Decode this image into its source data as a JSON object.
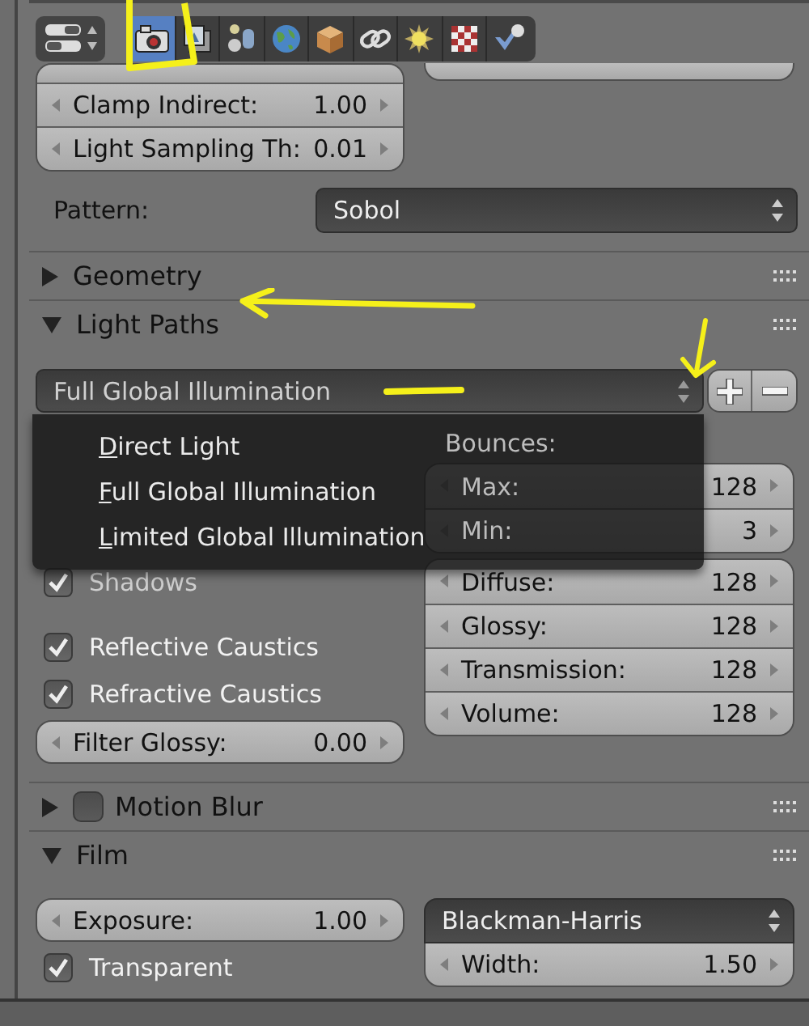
{
  "tab_bar": {
    "icons": [
      {
        "kind": "camera",
        "selected": true
      },
      {
        "kind": "layers",
        "selected": false
      },
      {
        "kind": "scene",
        "selected": false
      },
      {
        "kind": "world",
        "selected": false
      },
      {
        "kind": "object",
        "selected": false
      },
      {
        "kind": "chain",
        "selected": false
      },
      {
        "kind": "sun",
        "selected": false
      },
      {
        "kind": "checker",
        "selected": false
      },
      {
        "kind": "check",
        "selected": false
      }
    ]
  },
  "sampling": {
    "fields": [
      {
        "label": "Clamp Indirect:",
        "value": "1.00"
      },
      {
        "label": "Light Sampling Th:",
        "value": "0.01"
      }
    ],
    "pattern": {
      "label": "Pattern:",
      "value": "Sobol"
    }
  },
  "geometry": {
    "title": "Geometry",
    "expanded": false
  },
  "light_paths": {
    "title": "Light Paths",
    "expanded": true,
    "preset": "Full Global Illumination",
    "preset_menu": [
      "Direct Light",
      "Full Global Illumination",
      "Limited Global Illumination"
    ],
    "bounces_label": "Bounces:",
    "bounces": [
      {
        "label": "Max:",
        "value": "128"
      },
      {
        "label": "Min:",
        "value": "3"
      }
    ],
    "bounce_types": [
      {
        "label": "Diffuse:",
        "value": "128"
      },
      {
        "label": "Glossy:",
        "value": "128"
      },
      {
        "label": "Transmission:",
        "value": "128"
      },
      {
        "label": "Volume:",
        "value": "128"
      }
    ],
    "shadows": {
      "label": "Shadows",
      "checked": true
    },
    "caustics": [
      {
        "label": "Reflective Caustics",
        "checked": true
      },
      {
        "label": "Refractive Caustics",
        "checked": true
      }
    ],
    "filter_glossy": {
      "label": "Filter Glossy:",
      "value": "0.00"
    }
  },
  "motion_blur": {
    "title": "Motion Blur",
    "expanded": false,
    "enabled": false
  },
  "film": {
    "title": "Film",
    "expanded": true,
    "exposure": {
      "label": "Exposure:",
      "value": "1.00"
    },
    "filter": "Blackman-Harris",
    "width": {
      "label": "Width:",
      "value": "1.50"
    },
    "transparent": {
      "label": "Transparent",
      "checked": true
    }
  }
}
